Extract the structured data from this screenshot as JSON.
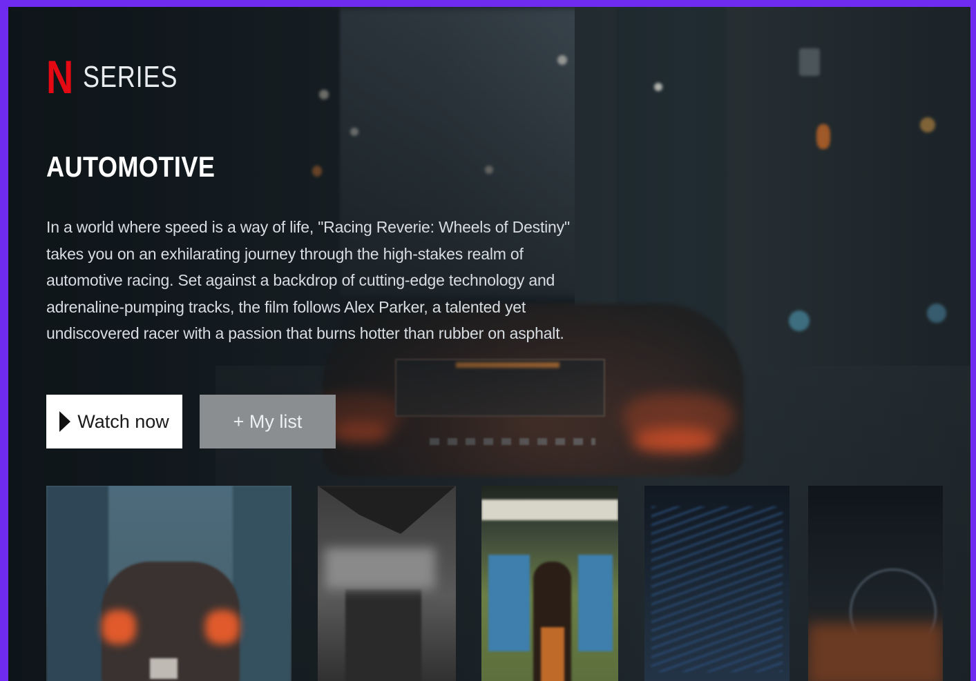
{
  "brand": {
    "logo_letter": "N",
    "logo_label": "SERIES",
    "accent_color": "#e50914"
  },
  "hero": {
    "title": "AUTOMOTIVE",
    "description": "In a world where speed is a way of life, \"Racing Reverie: Wheels of Destiny\" takes you on an exhilarating journey through the high-stakes realm of automotive racing. Set against a backdrop of cutting-edge technology and adrenaline-pumping tracks, the film follows Alex Parker, a talented yet undiscovered racer with a passion that burns hotter than rubber on asphalt."
  },
  "actions": {
    "watch_label": "Watch now",
    "list_label": "+ My list",
    "watch_icon": "play-icon"
  },
  "frame_color": "#6f2cf0"
}
